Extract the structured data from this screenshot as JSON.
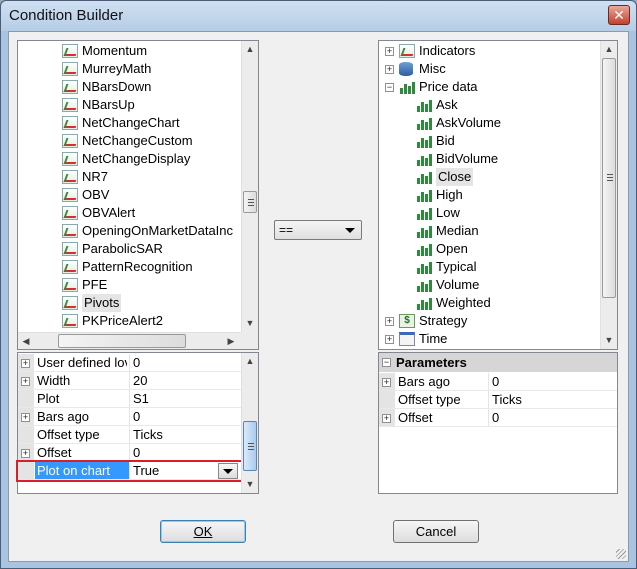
{
  "window": {
    "title": "Condition Builder",
    "close_glyph": "✕"
  },
  "left_tree": {
    "items": [
      {
        "label": "Momentum"
      },
      {
        "label": "MurreyMath"
      },
      {
        "label": "NBarsDown"
      },
      {
        "label": "NBarsUp"
      },
      {
        "label": "NetChangeChart"
      },
      {
        "label": "NetChangeCustom"
      },
      {
        "label": "NetChangeDisplay"
      },
      {
        "label": "NR7"
      },
      {
        "label": "OBV"
      },
      {
        "label": "OBVAlert"
      },
      {
        "label": "OpeningOnMarketDataInc"
      },
      {
        "label": "ParabolicSAR"
      },
      {
        "label": "PatternRecognition"
      },
      {
        "label": "PFE"
      },
      {
        "label": "Pivots",
        "selected": true
      },
      {
        "label": "PKPriceAlert2"
      }
    ],
    "icon": "indicator-chart-icon"
  },
  "left_props": {
    "rows": [
      {
        "expandable": true,
        "name": "User defined lov",
        "value": "0"
      },
      {
        "expandable": true,
        "name": "Width",
        "value": "20"
      },
      {
        "expandable": false,
        "name": "Plot",
        "value": "S1"
      },
      {
        "expandable": true,
        "name": "Bars ago",
        "value": "0"
      },
      {
        "expandable": false,
        "name": "Offset type",
        "value": "Ticks"
      },
      {
        "expandable": true,
        "name": "Offset",
        "value": "0"
      },
      {
        "expandable": false,
        "name": "Plot on chart",
        "value": "True",
        "selected": true
      }
    ]
  },
  "operator": {
    "value": "=="
  },
  "right_tree": {
    "items": [
      {
        "label": "Indicators",
        "level": 0,
        "expander": "+",
        "icon": "indicators-icon"
      },
      {
        "label": "Misc",
        "level": 0,
        "expander": "+",
        "icon": "database-icon"
      },
      {
        "label": "Price data",
        "level": 0,
        "expander": "−",
        "icon": "price-data-icon"
      },
      {
        "label": "Ask",
        "level": 1,
        "icon": "bar-chart-icon"
      },
      {
        "label": "AskVolume",
        "level": 1,
        "icon": "bar-chart-icon"
      },
      {
        "label": "Bid",
        "level": 1,
        "icon": "bar-chart-icon"
      },
      {
        "label": "BidVolume",
        "level": 1,
        "icon": "bar-chart-icon"
      },
      {
        "label": "Close",
        "level": 1,
        "icon": "bar-chart-icon",
        "selected": true
      },
      {
        "label": "High",
        "level": 1,
        "icon": "bar-chart-icon"
      },
      {
        "label": "Low",
        "level": 1,
        "icon": "bar-chart-icon"
      },
      {
        "label": "Median",
        "level": 1,
        "icon": "bar-chart-icon"
      },
      {
        "label": "Open",
        "level": 1,
        "icon": "bar-chart-icon"
      },
      {
        "label": "Typical",
        "level": 1,
        "icon": "bar-chart-icon"
      },
      {
        "label": "Volume",
        "level": 1,
        "icon": "bar-chart-icon"
      },
      {
        "label": "Weighted",
        "level": 1,
        "icon": "bar-chart-icon"
      },
      {
        "label": "Strategy",
        "level": 0,
        "expander": "+",
        "icon": "strategy-icon"
      },
      {
        "label": "Time",
        "level": 0,
        "expander": "+",
        "icon": "time-icon"
      }
    ]
  },
  "right_props": {
    "header": "Parameters",
    "rows": [
      {
        "expandable": true,
        "name": "Bars ago",
        "value": "0"
      },
      {
        "expandable": false,
        "name": "Offset type",
        "value": "Ticks"
      },
      {
        "expandable": true,
        "name": "Offset",
        "value": "0"
      }
    ]
  },
  "buttons": {
    "ok": "OK",
    "cancel": "Cancel"
  },
  "colors": {
    "highlight_border": "#d9202a",
    "selection_blue": "#3399ff"
  }
}
